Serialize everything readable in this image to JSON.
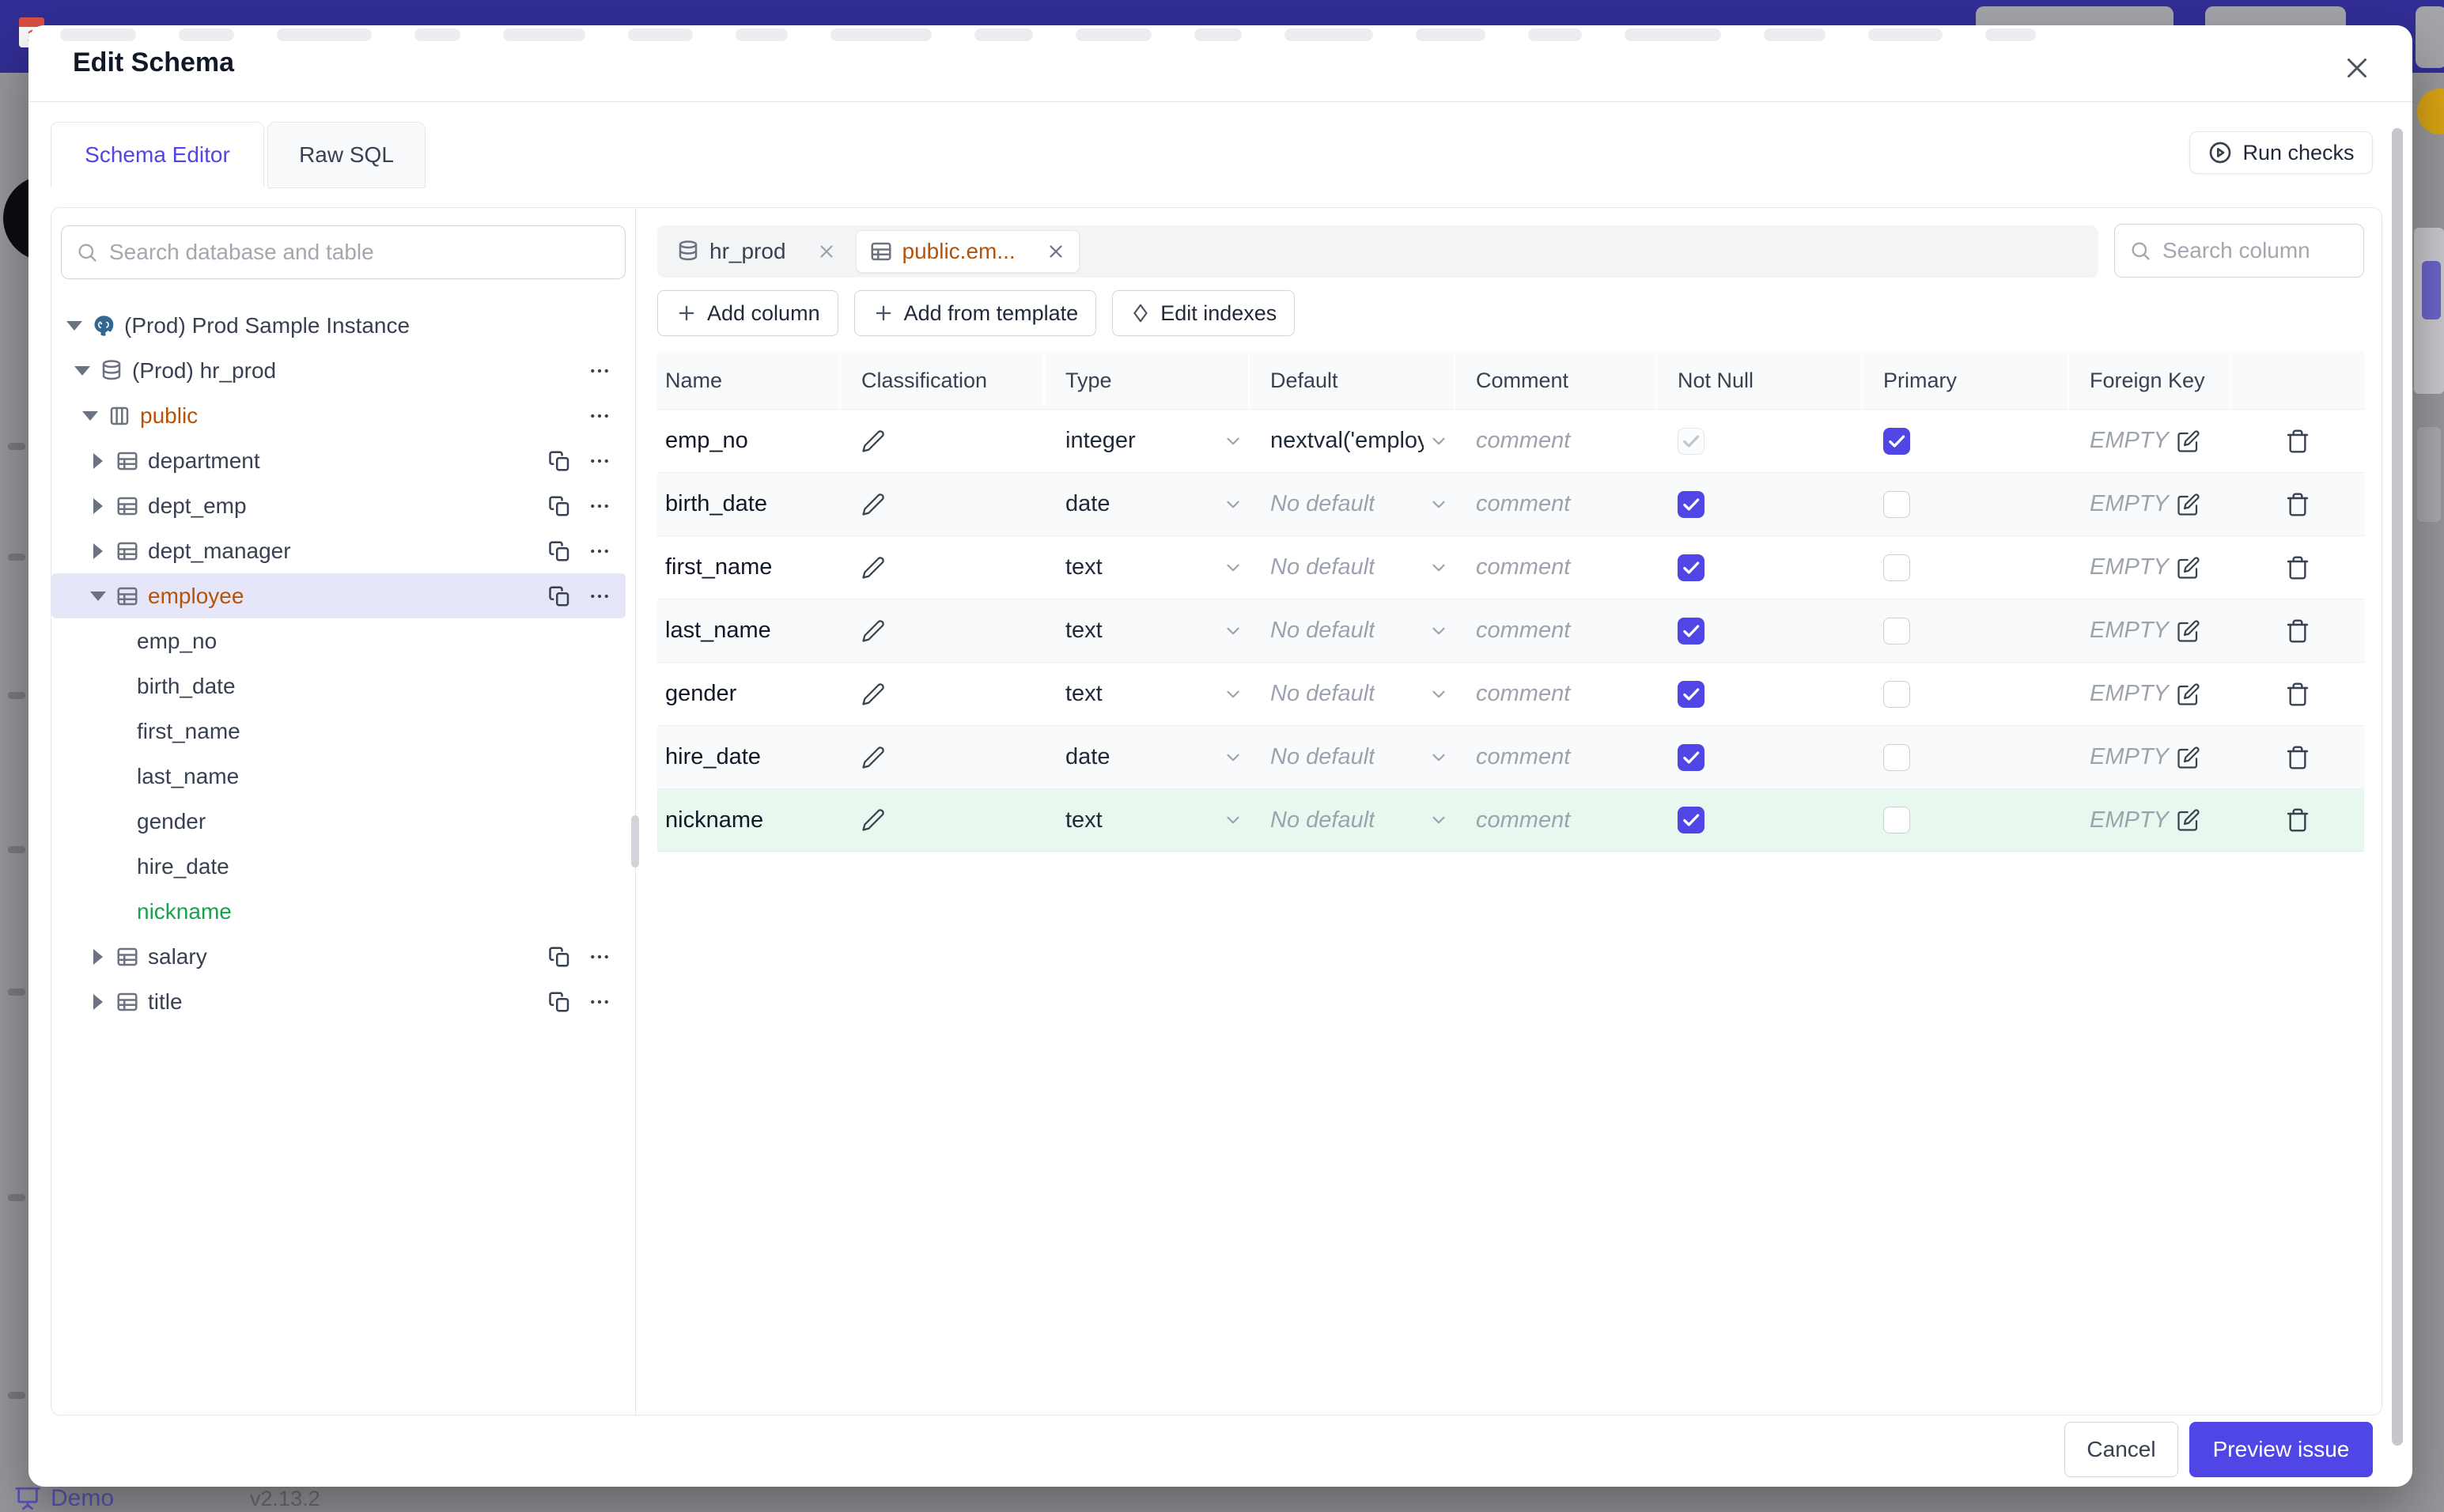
{
  "backdrop": {
    "demo_label": "Demo",
    "version": "v2.13.2"
  },
  "modal": {
    "title": "Edit Schema",
    "tabs": [
      {
        "label": "Schema Editor",
        "active": true
      },
      {
        "label": "Raw SQL",
        "active": false
      }
    ],
    "run_checks_label": "Run checks",
    "sidebar": {
      "search_placeholder": "Search database and table",
      "tree": [
        {
          "label": "(Prod) Prod Sample Instance",
          "level": 0,
          "icon": "postgres",
          "caret": "down",
          "color": "default",
          "actions": []
        },
        {
          "label": "(Prod) hr_prod",
          "level": 1,
          "icon": "database",
          "caret": "down",
          "color": "default",
          "actions": [
            "menu"
          ]
        },
        {
          "label": "public",
          "level": 2,
          "icon": "schema",
          "caret": "down",
          "color": "amber",
          "actions": [
            "menu"
          ]
        },
        {
          "label": "department",
          "level": 3,
          "icon": "table",
          "caret": "right",
          "color": "default",
          "actions": [
            "copy",
            "menu"
          ]
        },
        {
          "label": "dept_emp",
          "level": 3,
          "icon": "table",
          "caret": "right",
          "color": "default",
          "actions": [
            "copy",
            "menu"
          ]
        },
        {
          "label": "dept_manager",
          "level": 3,
          "icon": "table",
          "caret": "right",
          "color": "default",
          "actions": [
            "copy",
            "menu"
          ]
        },
        {
          "label": "employee",
          "level": 3,
          "icon": "table",
          "caret": "down",
          "color": "amber",
          "selected": true,
          "actions": [
            "copy",
            "menu"
          ]
        },
        {
          "label": "emp_no",
          "level": "col",
          "color": "default",
          "actions": []
        },
        {
          "label": "birth_date",
          "level": "col",
          "color": "default",
          "actions": []
        },
        {
          "label": "first_name",
          "level": "col",
          "color": "default",
          "actions": []
        },
        {
          "label": "last_name",
          "level": "col",
          "color": "default",
          "actions": []
        },
        {
          "label": "gender",
          "level": "col",
          "color": "default",
          "actions": []
        },
        {
          "label": "hire_date",
          "level": "col",
          "color": "default",
          "actions": []
        },
        {
          "label": "nickname",
          "level": "col",
          "color": "green",
          "actions": []
        },
        {
          "label": "salary",
          "level": 3,
          "icon": "table",
          "caret": "right",
          "color": "default",
          "actions": [
            "copy",
            "menu"
          ]
        },
        {
          "label": "title",
          "level": 3,
          "icon": "table",
          "caret": "right",
          "color": "default",
          "actions": [
            "copy",
            "menu"
          ]
        }
      ]
    },
    "editor": {
      "tabs": [
        {
          "label": "hr_prod",
          "icon": "database",
          "active": false
        },
        {
          "label": "public.em...",
          "icon": "table",
          "active": true
        }
      ],
      "column_search_placeholder": "Search column",
      "toolbar": [
        {
          "label": "Add column",
          "icon": "plus"
        },
        {
          "label": "Add from template",
          "icon": "plus"
        },
        {
          "label": "Edit indexes",
          "icon": "diamond"
        }
      ],
      "table": {
        "headers": [
          "Name",
          "Classification",
          "Type",
          "Default",
          "Comment",
          "Not Null",
          "Primary",
          "Foreign Key",
          ""
        ],
        "comment_placeholder": "comment",
        "fk_label": "EMPTY",
        "rows": [
          {
            "name": "emp_no",
            "type": "integer",
            "default": "nextval('employ",
            "default_is_value": true,
            "not_null": "checked-disabled",
            "primary": "checked",
            "highlight": "none"
          },
          {
            "name": "birth_date",
            "type": "date",
            "default": "No default",
            "default_is_value": false,
            "not_null": "checked",
            "primary": "unchecked",
            "highlight": "none"
          },
          {
            "name": "first_name",
            "type": "text",
            "default": "No default",
            "default_is_value": false,
            "not_null": "checked",
            "primary": "unchecked",
            "highlight": "none"
          },
          {
            "name": "last_name",
            "type": "text",
            "default": "No default",
            "default_is_value": false,
            "not_null": "checked",
            "primary": "unchecked",
            "highlight": "none"
          },
          {
            "name": "gender",
            "type": "text",
            "default": "No default",
            "default_is_value": false,
            "not_null": "checked",
            "primary": "unchecked",
            "highlight": "none"
          },
          {
            "name": "hire_date",
            "type": "date",
            "default": "No default",
            "default_is_value": false,
            "not_null": "checked",
            "primary": "unchecked",
            "highlight": "none"
          },
          {
            "name": "nickname",
            "type": "text",
            "default": "No default",
            "default_is_value": false,
            "not_null": "checked",
            "primary": "unchecked",
            "highlight": "new"
          }
        ]
      }
    },
    "footer": {
      "cancel_label": "Cancel",
      "primary_label": "Preview issue"
    }
  },
  "colors": {
    "accent": "#4f46e5",
    "amber": "#b45309",
    "green": "#16a34a",
    "topbar": "#322d95"
  }
}
